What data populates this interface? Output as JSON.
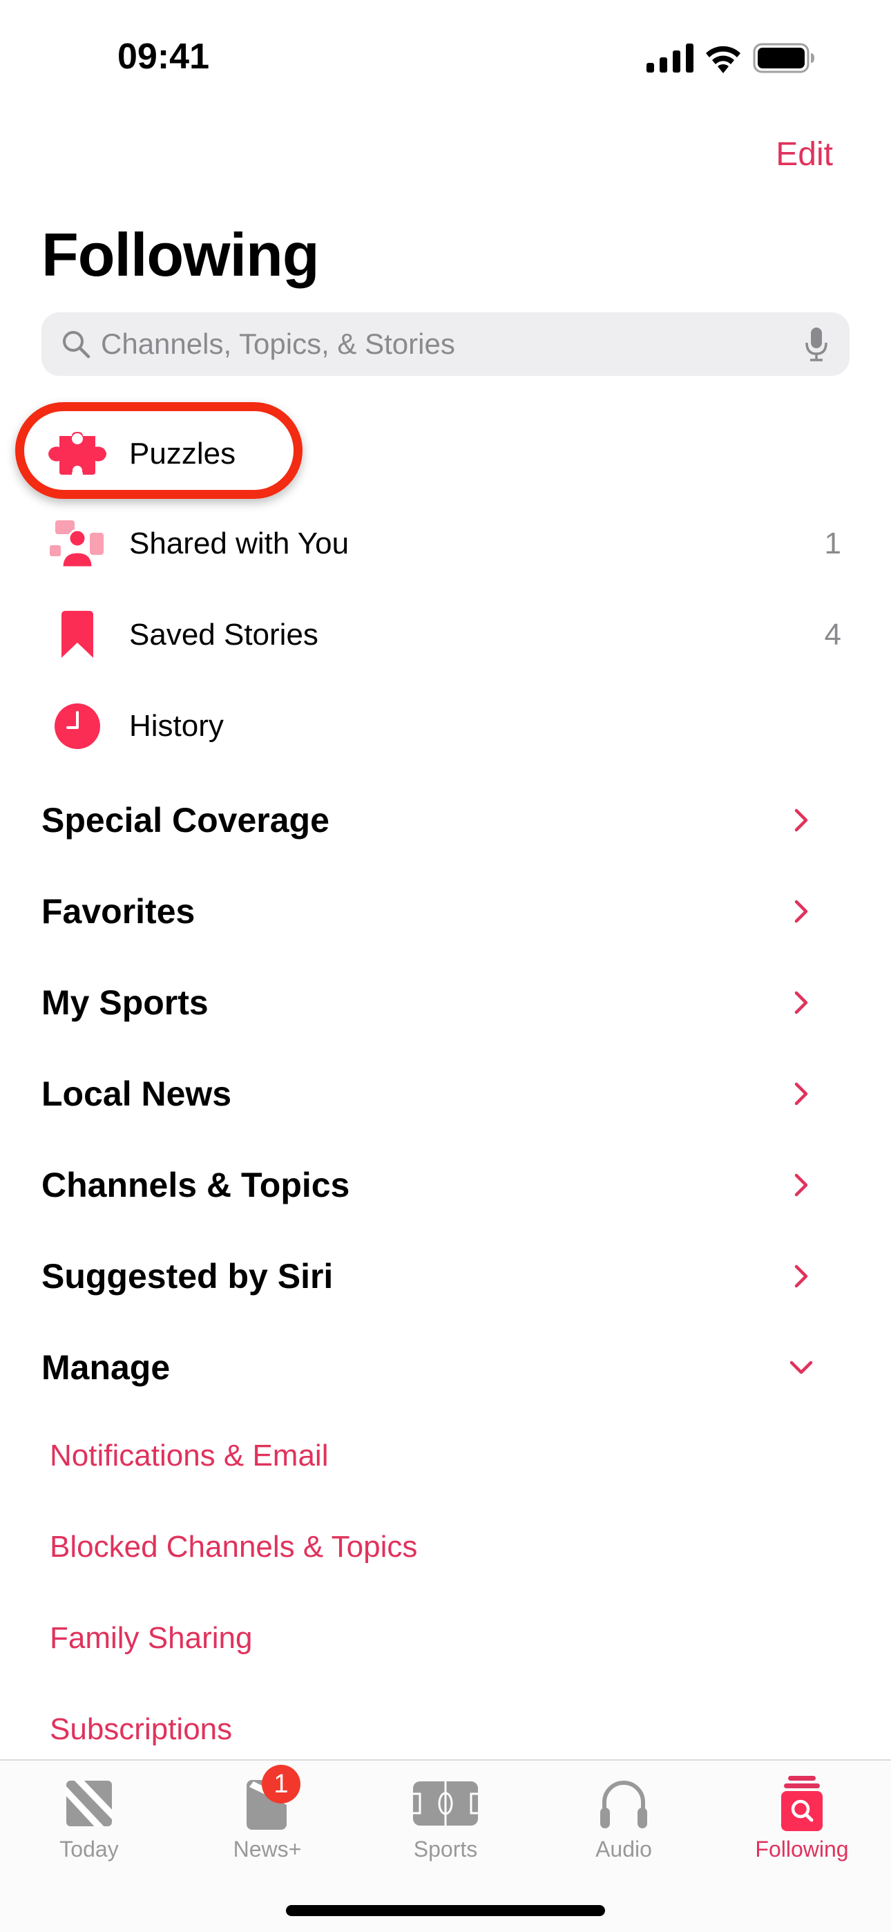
{
  "status_bar": {
    "time": "09:41",
    "icons": [
      "cellular-signal-icon",
      "wifi-icon",
      "battery-icon"
    ]
  },
  "header": {
    "edit_label": "Edit",
    "title": "Following"
  },
  "search": {
    "placeholder": "Channels, Topics, & Stories",
    "value": "",
    "left_icon": "search-icon",
    "right_icon": "microphone-icon"
  },
  "library": [
    {
      "label": "Puzzles",
      "icon": "puzzle-icon",
      "count": "",
      "highlighted": true
    },
    {
      "label": "Shared with You",
      "icon": "shared-with-you-icon",
      "count": "1"
    },
    {
      "label": "Saved Stories",
      "icon": "bookmark-icon",
      "count": "4"
    },
    {
      "label": "History",
      "icon": "clock-icon",
      "count": ""
    }
  ],
  "sections": [
    {
      "label": "Special Coverage",
      "chevron": "chevron-right-icon"
    },
    {
      "label": "Favorites",
      "chevron": "chevron-right-icon"
    },
    {
      "label": "My Sports",
      "chevron": "chevron-right-icon"
    },
    {
      "label": "Local News",
      "chevron": "chevron-right-icon"
    },
    {
      "label": "Channels & Topics",
      "chevron": "chevron-right-icon"
    },
    {
      "label": "Suggested by Siri",
      "chevron": "chevron-right-icon"
    },
    {
      "label": "Manage",
      "chevron": "chevron-down-icon",
      "expanded": true
    }
  ],
  "manage_links": [
    "Notifications & Email",
    "Blocked Channels & Topics",
    "Family Sharing",
    "Subscriptions"
  ],
  "tab_bar": {
    "tabs": [
      {
        "label": "Today",
        "icon": "news-today-icon",
        "active": false
      },
      {
        "label": "News+",
        "icon": "news-plus-icon",
        "active": false,
        "badge": "1"
      },
      {
        "label": "Sports",
        "icon": "sports-field-icon",
        "active": false
      },
      {
        "label": "Audio",
        "icon": "headphones-icon",
        "active": false
      },
      {
        "label": "Following",
        "icon": "following-search-icon",
        "active": true
      }
    ]
  },
  "colors": {
    "accent": "#e0325c",
    "icon_pink": "#fb2d55",
    "highlight_ring": "#f22b12",
    "inactive_gray": "#999999",
    "badge_red": "#f2382c"
  }
}
